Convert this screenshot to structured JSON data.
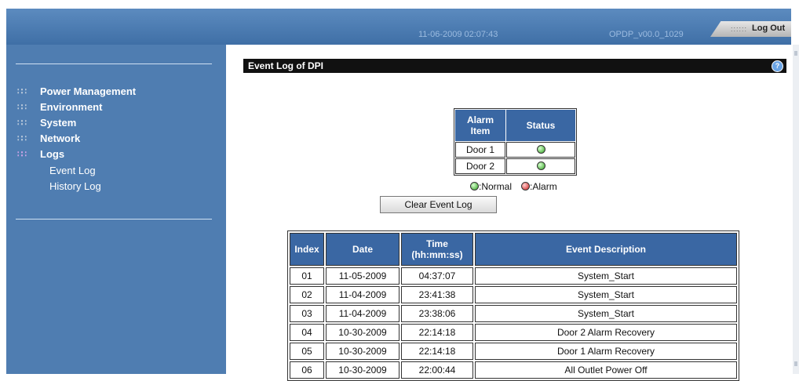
{
  "header": {
    "datetime": "11-06-2009 02:07:43",
    "version": "OPDP_v00.0_1029",
    "logout_label": "Log Out",
    "logout_dots": "::::::"
  },
  "sidebar": {
    "icon_glyph": "∷∷",
    "items": [
      {
        "label": "Power Management",
        "active": false
      },
      {
        "label": "Environment",
        "active": false
      },
      {
        "label": "System",
        "active": false
      },
      {
        "label": "Network",
        "active": false
      },
      {
        "label": "Logs",
        "active": true
      }
    ],
    "sub_items": [
      {
        "label": "Event Log"
      },
      {
        "label": "History Log"
      }
    ]
  },
  "content": {
    "title": "Event Log of DPI",
    "help_icon": "?"
  },
  "alarm_table": {
    "headers": {
      "item": "Alarm Item",
      "status": "Status"
    },
    "rows": [
      {
        "item": "Door  1",
        "status": "normal"
      },
      {
        "item": "Door  2",
        "status": "normal"
      }
    ]
  },
  "legend": {
    "normal_label": ":Normal",
    "alarm_label": ":Alarm",
    "colors": {
      "normal": "#2fa21f",
      "alarm": "#cc1a1a"
    }
  },
  "clear_button_label": "Clear Event Log",
  "event_table": {
    "headers": {
      "index": "Index",
      "date": "Date",
      "time": "Time (hh:mm:ss)",
      "description": "Event Description"
    },
    "rows": [
      {
        "index": "01",
        "date": "11-05-2009",
        "time": "04:37:07",
        "description": "System_Start"
      },
      {
        "index": "02",
        "date": "11-04-2009",
        "time": "23:41:38",
        "description": "System_Start"
      },
      {
        "index": "03",
        "date": "11-04-2009",
        "time": "23:38:06",
        "description": "System_Start"
      },
      {
        "index": "04",
        "date": "10-30-2009",
        "time": "22:14:18",
        "description": "Door 2 Alarm Recovery"
      },
      {
        "index": "05",
        "date": "10-30-2009",
        "time": "22:14:18",
        "description": "Door 1 Alarm Recovery"
      },
      {
        "index": "06",
        "date": "10-30-2009",
        "time": "22:00:44",
        "description": "All Outlet Power Off"
      }
    ]
  },
  "colors": {
    "header_blue": "#3f6fa6",
    "sidebar_blue": "#4f7db1",
    "table_header": "#3a67a3"
  }
}
